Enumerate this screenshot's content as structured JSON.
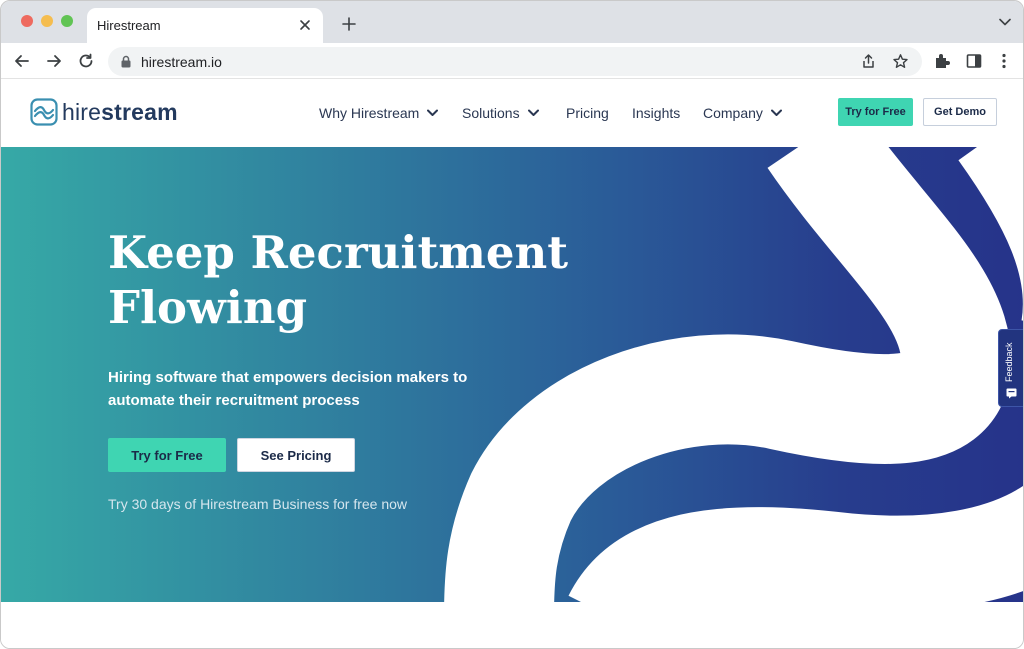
{
  "browser": {
    "tab_title": "Hirestream",
    "url": "hirestream.io",
    "icons": [
      "close-icon",
      "plus-icon",
      "chevron-down-icon",
      "back-arrow-icon",
      "forward-arrow-icon",
      "reload-icon",
      "lock-icon",
      "share-icon",
      "star-icon",
      "extensions-icon",
      "sidebar-icon",
      "more-vertical-icon"
    ]
  },
  "header": {
    "logo": {
      "prefix": "hire",
      "suffix": "stream"
    },
    "nav": [
      {
        "label": "Why Hirestream",
        "has_dropdown": true
      },
      {
        "label": "Solutions",
        "has_dropdown": true
      },
      {
        "label": "Pricing",
        "has_dropdown": false
      },
      {
        "label": "Insights",
        "has_dropdown": false
      },
      {
        "label": "Company",
        "has_dropdown": true
      }
    ],
    "try_label": "Try for Free",
    "demo_label": "Get Demo"
  },
  "hero": {
    "title_line1": "Keep Recruitment",
    "title_line2": "Flowing",
    "subtitle": "Hiring software that empowers decision makers to automate their recruitment process",
    "primary_cta": "Try for Free",
    "secondary_cta": "See Pricing",
    "note": "Try 30 days of Hirestream Business for free now"
  },
  "feedback": {
    "label": "Feedback"
  },
  "colors": {
    "accent": "#3fd5b2",
    "navy": "#233a5e",
    "hero_start": "#36a9a6",
    "hero_end": "#26338a"
  }
}
